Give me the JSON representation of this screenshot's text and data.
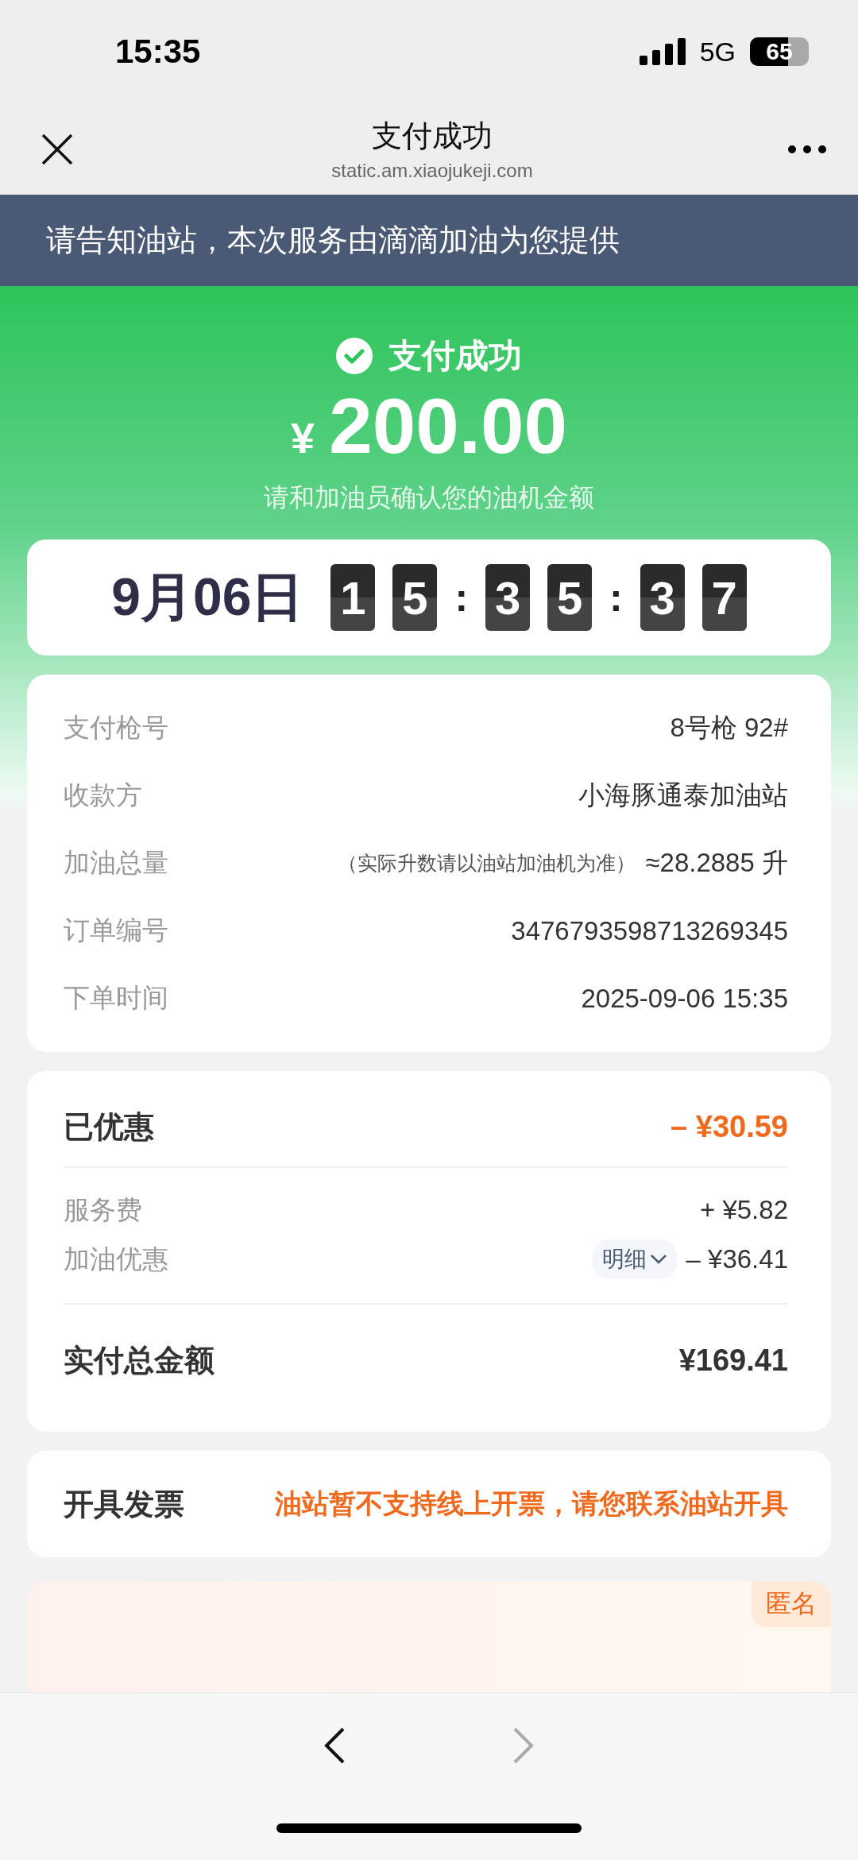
{
  "status_bar": {
    "time": "15:35",
    "network": "5G",
    "battery": "65"
  },
  "nav": {
    "title": "支付成功",
    "url": "static.am.xiaojukeji.com"
  },
  "notice": "请告知油站，本次服务由滴滴加油为您提供",
  "hero": {
    "status": "支付成功",
    "currency": "¥",
    "amount": "200.00",
    "hint": "请和加油员确认您的油机金额"
  },
  "clock": {
    "date": "9月06日",
    "groups": [
      [
        "1",
        "5"
      ],
      [
        "3",
        "5"
      ],
      [
        "3",
        "7"
      ]
    ],
    "separators": [
      ":",
      ":"
    ]
  },
  "details": [
    {
      "label": "支付枪号",
      "value": "8号枪 92#"
    },
    {
      "label": "收款方",
      "value": "小海豚通泰加油站"
    },
    {
      "label": "加油总量",
      "note": "（实际升数请以油站加油机为准）",
      "value": "≈28.2885 升"
    },
    {
      "label": "订单编号",
      "value": "3476793598713269345"
    },
    {
      "label": "下单时间",
      "value": "2025-09-06 15:35"
    }
  ],
  "discount": {
    "label": "已优惠",
    "value": "– ¥30.59",
    "items": [
      {
        "label": "服务费",
        "value": "+ ¥5.82"
      },
      {
        "label": "加油优惠",
        "link": "明细",
        "expanded": false,
        "value": "– ¥36.41"
      }
    ],
    "total_label": "实付总金额",
    "total_value": "¥169.41"
  },
  "invoice": {
    "label": "开具发票",
    "message": "油站暂不支持线上开票，请您联系油站开具"
  },
  "survey": {
    "badge": "匿名"
  }
}
